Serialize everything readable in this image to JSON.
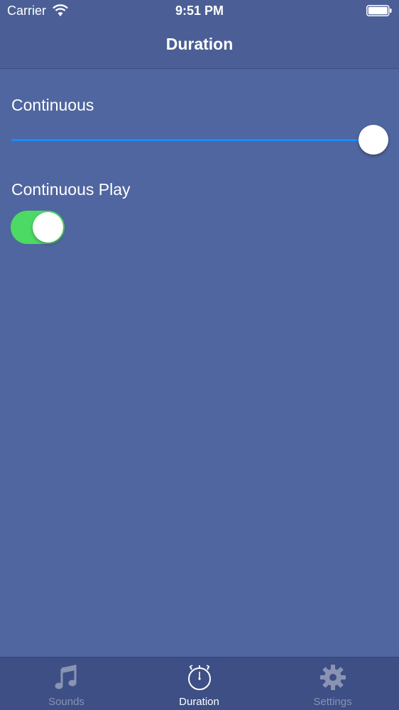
{
  "status_bar": {
    "carrier": "Carrier",
    "time": "9:51 PM"
  },
  "nav": {
    "title": "Duration"
  },
  "continuous": {
    "label": "Continuous",
    "slider_value": 1.0
  },
  "continuous_play": {
    "label": "Continuous Play",
    "enabled": true
  },
  "tabs": [
    {
      "label": "Sounds",
      "icon": "music-note-icon",
      "active": false
    },
    {
      "label": "Duration",
      "icon": "stopwatch-icon",
      "active": true
    },
    {
      "label": "Settings",
      "icon": "gear-icon",
      "active": false
    }
  ],
  "colors": {
    "background": "#5066a0",
    "bar": "#4b5f96",
    "tab_bar": "#3d4f85",
    "slider_accent": "#1a8cff",
    "toggle_on": "#4cd964",
    "tab_inactive": "#8b93b3"
  }
}
